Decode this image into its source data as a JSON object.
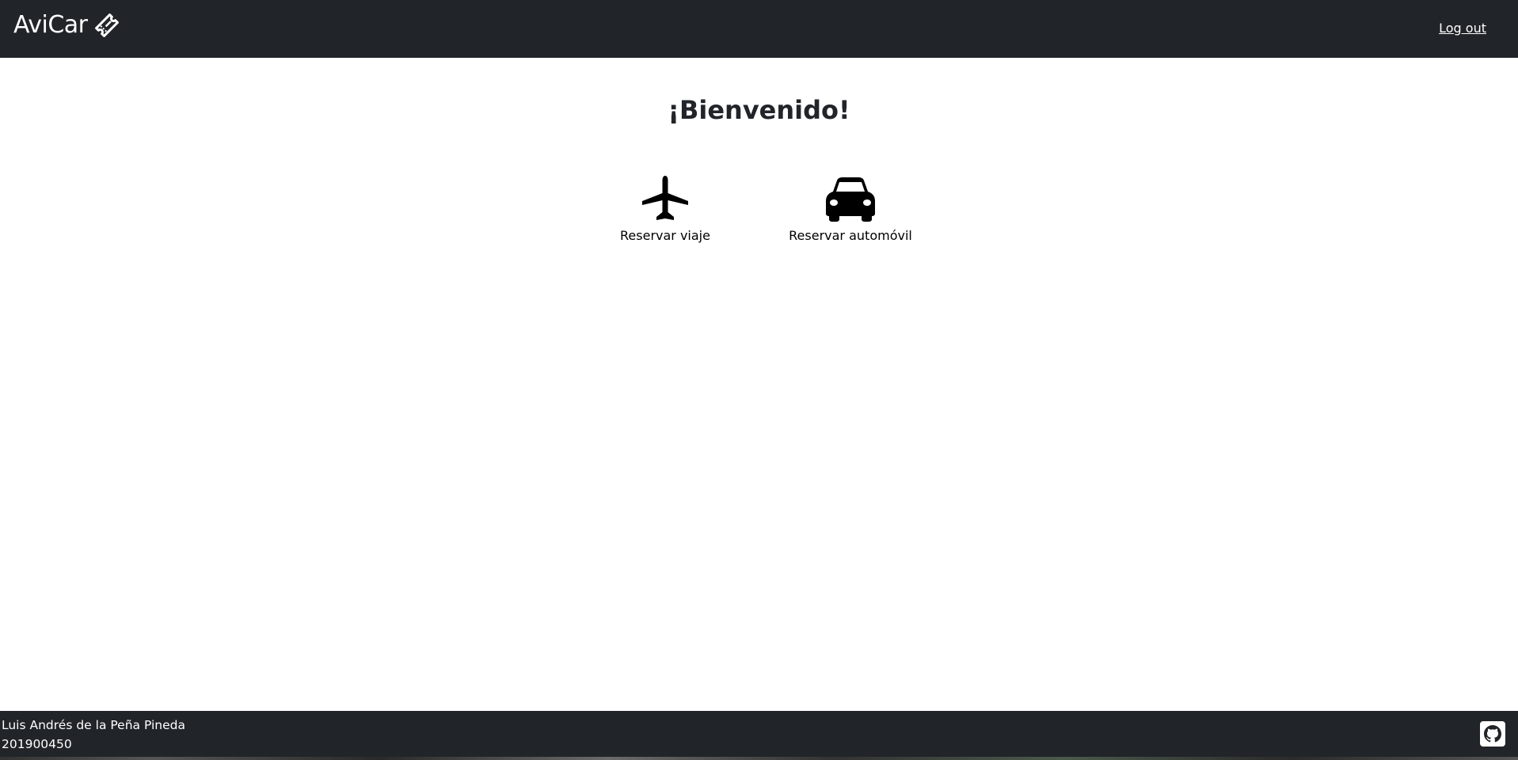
{
  "navbar": {
    "brand": "AviCar",
    "brand_icon": "ticket-icon",
    "logout_label": "Log out"
  },
  "main": {
    "title": "¡Bienvenido!",
    "options": [
      {
        "label": "Reservar viaje",
        "icon": "airplane-icon"
      },
      {
        "label": "Reservar automóvil",
        "icon": "car-icon"
      }
    ]
  },
  "footer": {
    "name": "Luis Andrés de la Peña Pineda",
    "id": "201900450",
    "github_icon": "github-icon"
  },
  "colors": {
    "navbar_bg": "#212529",
    "footer_bg": "#212529",
    "text_light": "#ffffff",
    "text_dark": "#212529"
  }
}
